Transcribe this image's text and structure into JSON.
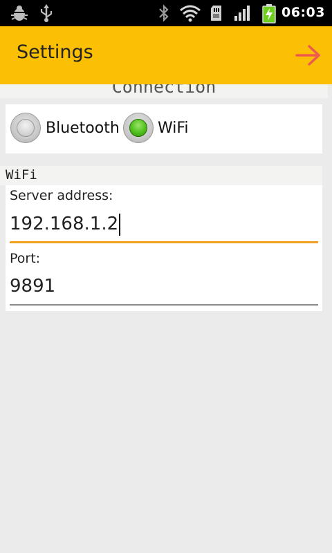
{
  "status_bar": {
    "time": "06:03",
    "icons": [
      "bug-icon",
      "usb-icon",
      "bluetooth-icon",
      "wifi-icon",
      "sd-card-icon",
      "signal-icon",
      "battery-charging-icon"
    ]
  },
  "action_bar": {
    "title": "Settings",
    "next_icon": "arrow-right-icon",
    "accent_color": "#fbc004",
    "arrow_color": "#ef5a4f"
  },
  "connection_section": {
    "header": "Connection",
    "options": [
      {
        "label": "Bluetooth",
        "checked": false
      },
      {
        "label": "WiFi",
        "checked": true
      }
    ]
  },
  "wifi_section": {
    "header": "WiFi",
    "server_address": {
      "label": "Server address:",
      "value": "192.168.1.2"
    },
    "port": {
      "label": "Port:",
      "value": "9891"
    }
  }
}
